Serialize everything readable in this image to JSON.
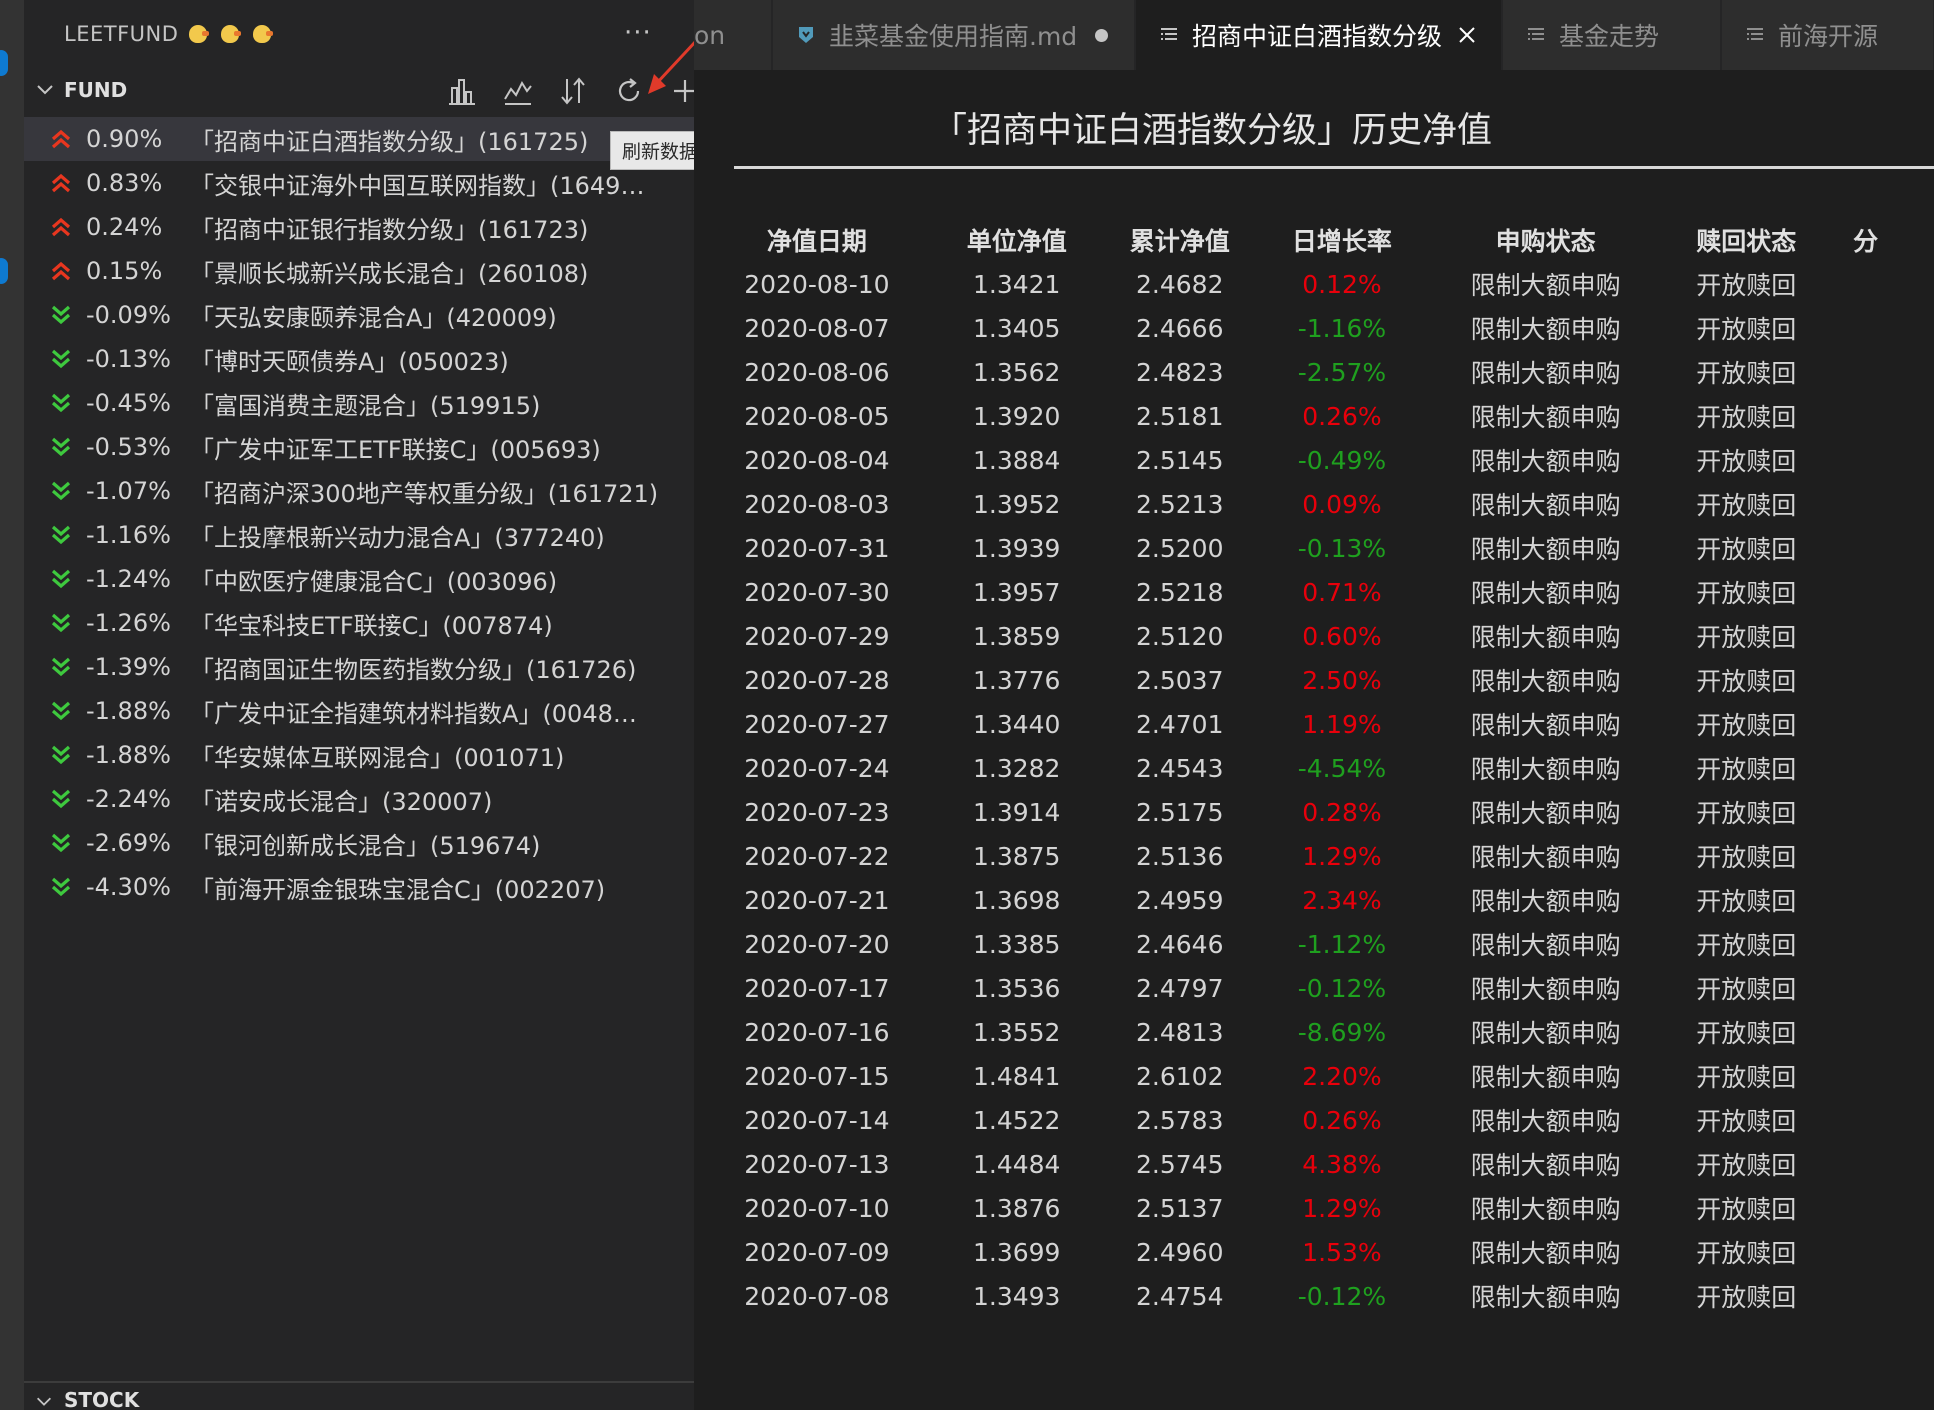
{
  "sidebar": {
    "title": "LEETFUND",
    "title_icon": "chick-emoji",
    "more_label": "···",
    "fund_section": {
      "title": "FUND",
      "toolbar_icons": [
        "bar-chart-icon",
        "line-chart-icon",
        "sort-icon",
        "refresh-icon",
        "add-icon"
      ],
      "tooltip": "刷新数据"
    },
    "funds": [
      {
        "pct": "0.90%",
        "name": "「招商中证白酒指数分级」(161725)",
        "trend": "up"
      },
      {
        "pct": "0.83%",
        "name": "「交银中证海外中国互联网指数」(1649…",
        "trend": "up"
      },
      {
        "pct": "0.24%",
        "name": "「招商中证银行指数分级」(161723)",
        "trend": "up"
      },
      {
        "pct": "0.15%",
        "name": "「景顺长城新兴成长混合」(260108)",
        "trend": "up"
      },
      {
        "pct": "-0.09%",
        "name": "「天弘安康颐养混合A」(420009)",
        "trend": "down"
      },
      {
        "pct": "-0.13%",
        "name": "「博时天颐债券A」(050023)",
        "trend": "down"
      },
      {
        "pct": "-0.45%",
        "name": "「富国消费主题混合」(519915)",
        "trend": "down"
      },
      {
        "pct": "-0.53%",
        "name": "「广发中证军工ETF联接C」(005693)",
        "trend": "down"
      },
      {
        "pct": "-1.07%",
        "name": "「招商沪深300地产等权重分级」(161721)",
        "trend": "down"
      },
      {
        "pct": "-1.16%",
        "name": "「上投摩根新兴动力混合A」(377240)",
        "trend": "down"
      },
      {
        "pct": "-1.24%",
        "name": "「中欧医疗健康混合C」(003096)",
        "trend": "down"
      },
      {
        "pct": "-1.26%",
        "name": "「华宝科技ETF联接C」(007874)",
        "trend": "down"
      },
      {
        "pct": "-1.39%",
        "name": "「招商国证生物医药指数分级」(161726)",
        "trend": "down"
      },
      {
        "pct": "-1.88%",
        "name": "「广发中证全指建筑材料指数A」(0048…",
        "trend": "down"
      },
      {
        "pct": "-1.88%",
        "name": "「华安媒体互联网混合」(001071)",
        "trend": "down"
      },
      {
        "pct": "-2.24%",
        "name": "「诺安成长混合」(320007)",
        "trend": "down"
      },
      {
        "pct": "-2.69%",
        "name": "「银河创新成长混合」(519674)",
        "trend": "down"
      },
      {
        "pct": "-4.30%",
        "name": "「前海开源金银珠宝混合C」(002207)",
        "trend": "down"
      }
    ],
    "stock_section": {
      "title": "STOCK"
    }
  },
  "tabs": [
    {
      "label": "on",
      "icon": "",
      "active": false
    },
    {
      "label": "韭菜基金使用指南.md",
      "icon": "markdown-icon",
      "active": false,
      "dirty": true
    },
    {
      "label": "招商中证白酒指数分级",
      "icon": "preview-icon",
      "active": true,
      "closable": true
    },
    {
      "label": "基金走势",
      "icon": "preview-icon",
      "active": false
    },
    {
      "label": "前海开源",
      "icon": "preview-icon",
      "active": false
    }
  ],
  "editor": {
    "title": "「招商中证白酒指数分级」历史净值",
    "columns": [
      "净值日期",
      "单位净值",
      "累计净值",
      "日增长率",
      "申购状态",
      "赎回状态",
      "分"
    ],
    "rows": [
      [
        "2020-08-10",
        "1.3421",
        "2.4682",
        "0.12%",
        "限制大额申购",
        "开放赎回"
      ],
      [
        "2020-08-07",
        "1.3405",
        "2.4666",
        "-1.16%",
        "限制大额申购",
        "开放赎回"
      ],
      [
        "2020-08-06",
        "1.3562",
        "2.4823",
        "-2.57%",
        "限制大额申购",
        "开放赎回"
      ],
      [
        "2020-08-05",
        "1.3920",
        "2.5181",
        "0.26%",
        "限制大额申购",
        "开放赎回"
      ],
      [
        "2020-08-04",
        "1.3884",
        "2.5145",
        "-0.49%",
        "限制大额申购",
        "开放赎回"
      ],
      [
        "2020-08-03",
        "1.3952",
        "2.5213",
        "0.09%",
        "限制大额申购",
        "开放赎回"
      ],
      [
        "2020-07-31",
        "1.3939",
        "2.5200",
        "-0.13%",
        "限制大额申购",
        "开放赎回"
      ],
      [
        "2020-07-30",
        "1.3957",
        "2.5218",
        "0.71%",
        "限制大额申购",
        "开放赎回"
      ],
      [
        "2020-07-29",
        "1.3859",
        "2.5120",
        "0.60%",
        "限制大额申购",
        "开放赎回"
      ],
      [
        "2020-07-28",
        "1.3776",
        "2.5037",
        "2.50%",
        "限制大额申购",
        "开放赎回"
      ],
      [
        "2020-07-27",
        "1.3440",
        "2.4701",
        "1.19%",
        "限制大额申购",
        "开放赎回"
      ],
      [
        "2020-07-24",
        "1.3282",
        "2.4543",
        "-4.54%",
        "限制大额申购",
        "开放赎回"
      ],
      [
        "2020-07-23",
        "1.3914",
        "2.5175",
        "0.28%",
        "限制大额申购",
        "开放赎回"
      ],
      [
        "2020-07-22",
        "1.3875",
        "2.5136",
        "1.29%",
        "限制大额申购",
        "开放赎回"
      ],
      [
        "2020-07-21",
        "1.3698",
        "2.4959",
        "2.34%",
        "限制大额申购",
        "开放赎回"
      ],
      [
        "2020-07-20",
        "1.3385",
        "2.4646",
        "-1.12%",
        "限制大额申购",
        "开放赎回"
      ],
      [
        "2020-07-17",
        "1.3536",
        "2.4797",
        "-0.12%",
        "限制大额申购",
        "开放赎回"
      ],
      [
        "2020-07-16",
        "1.3552",
        "2.4813",
        "-8.69%",
        "限制大额申购",
        "开放赎回"
      ],
      [
        "2020-07-15",
        "1.4841",
        "2.6102",
        "2.20%",
        "限制大额申购",
        "开放赎回"
      ],
      [
        "2020-07-14",
        "1.4522",
        "2.5783",
        "0.26%",
        "限制大额申购",
        "开放赎回"
      ],
      [
        "2020-07-13",
        "1.4484",
        "2.5745",
        "4.38%",
        "限制大额申购",
        "开放赎回"
      ],
      [
        "2020-07-10",
        "1.3876",
        "2.5137",
        "1.29%",
        "限制大额申购",
        "开放赎回"
      ],
      [
        "2020-07-09",
        "1.3699",
        "2.4960",
        "1.53%",
        "限制大额申购",
        "开放赎回"
      ],
      [
        "2020-07-08",
        "1.3493",
        "2.4754",
        "-0.12%",
        "限制大额申购",
        "开放赎回"
      ]
    ]
  },
  "colors": {
    "up": "#e8000b",
    "down": "#1fa01f",
    "up_icon": "#e8361f",
    "down_icon": "#3ec93e",
    "annotation_arrow": "#e03a2a"
  }
}
